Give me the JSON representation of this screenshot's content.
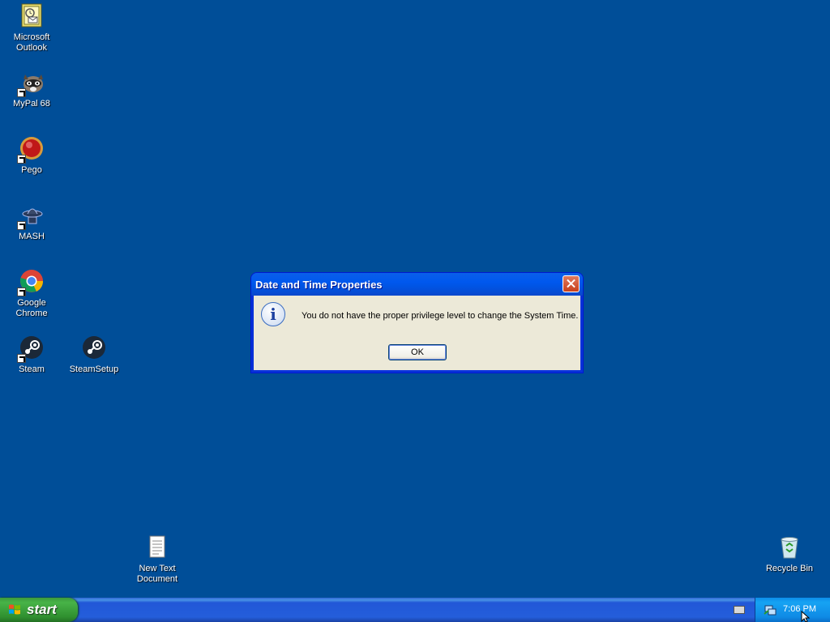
{
  "desktop": {
    "icons": [
      {
        "label": "Microsoft Outlook",
        "icon": "outlook-icon"
      },
      {
        "label": "MyPal 68",
        "icon": "mypal-icon"
      },
      {
        "label": "Pego",
        "icon": "pego-icon"
      },
      {
        "label": "MASH",
        "icon": "mash-icon"
      },
      {
        "label": "Google Chrome",
        "icon": "chrome-icon"
      },
      {
        "label": "Steam",
        "icon": "steam-icon"
      },
      {
        "label": "SteamSetup",
        "icon": "steam-setup-icon"
      },
      {
        "label": "New Text Document",
        "icon": "text-document-icon"
      },
      {
        "label": "Recycle Bin",
        "icon": "recycle-bin-icon"
      }
    ]
  },
  "dialog": {
    "title": "Date and Time Properties",
    "icon": "info-icon",
    "message": "You do not have the proper privilege level to change the System Time.",
    "ok_label": "OK"
  },
  "taskbar": {
    "start_label": "start",
    "clock": "7:06 PM"
  },
  "colors": {
    "desktop": "#004e98",
    "titlebar": "#0054e3",
    "dialog_body": "#ece9d8",
    "start": "#3c9a3c"
  }
}
